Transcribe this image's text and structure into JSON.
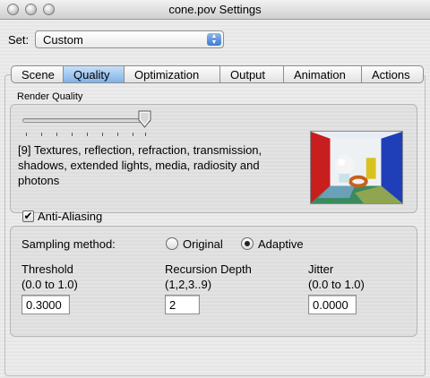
{
  "window": {
    "title": "cone.pov Settings"
  },
  "set": {
    "label": "Set:",
    "value": "Custom"
  },
  "tabs": [
    {
      "label": "Scene"
    },
    {
      "label": "Quality"
    },
    {
      "label": "Optimization"
    },
    {
      "label": "Output"
    },
    {
      "label": "Animation"
    },
    {
      "label": "Actions"
    }
  ],
  "selected_tab": "Quality",
  "render_quality": {
    "label": "Render Quality",
    "level": 9,
    "description": "[9] Textures, reflection, refraction, transmission, shadows, extended lights, media, radiosity and photons"
  },
  "anti_aliasing": {
    "label": "Anti-Aliasing",
    "checked": true,
    "sampling_label": "Sampling method:",
    "options": [
      "Original",
      "Adaptive"
    ],
    "selected": "Adaptive",
    "threshold": {
      "label": "Threshold",
      "range": "(0.0 to 1.0)",
      "value": "0.3000"
    },
    "recursion": {
      "label": "Recursion Depth",
      "range": "(1,2,3..9)",
      "value": "2"
    },
    "jitter": {
      "label": "Jitter",
      "range": "(0.0 to 1.0)",
      "value": "0.0000"
    }
  }
}
